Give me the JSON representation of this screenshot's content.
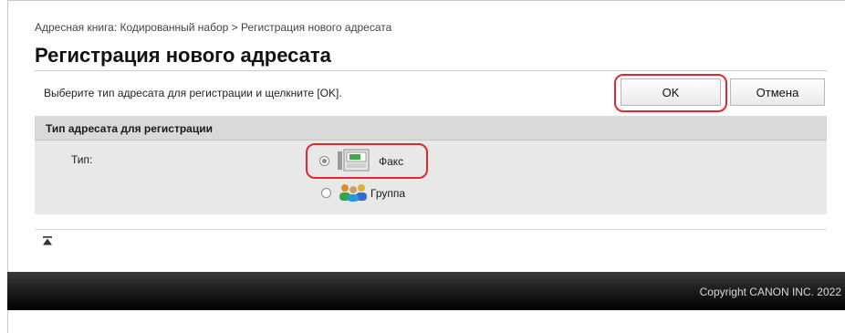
{
  "breadcrumb": "Адресная книга: Кодированный набор > Регистрация нового адресата",
  "page_title": "Регистрация нового адресата",
  "instruction": "Выберите тип адресата для регистрации и щелкните [OK].",
  "buttons": {
    "ok_label": "OK",
    "cancel_label": "Отмена"
  },
  "section": {
    "title": "Тип адресата для регистрации",
    "type_label": "Тип:",
    "options": [
      {
        "label": "Факс",
        "icon": "fax-icon",
        "selected": true
      },
      {
        "label": "Группа",
        "icon": "group-icon",
        "selected": false
      }
    ]
  },
  "footer": {
    "copyright": "Copyright CANON INC. 2022"
  },
  "colors": {
    "highlight": "#e0282e",
    "section_bg": "#e8e8e8",
    "footer_bg": "#000000"
  }
}
